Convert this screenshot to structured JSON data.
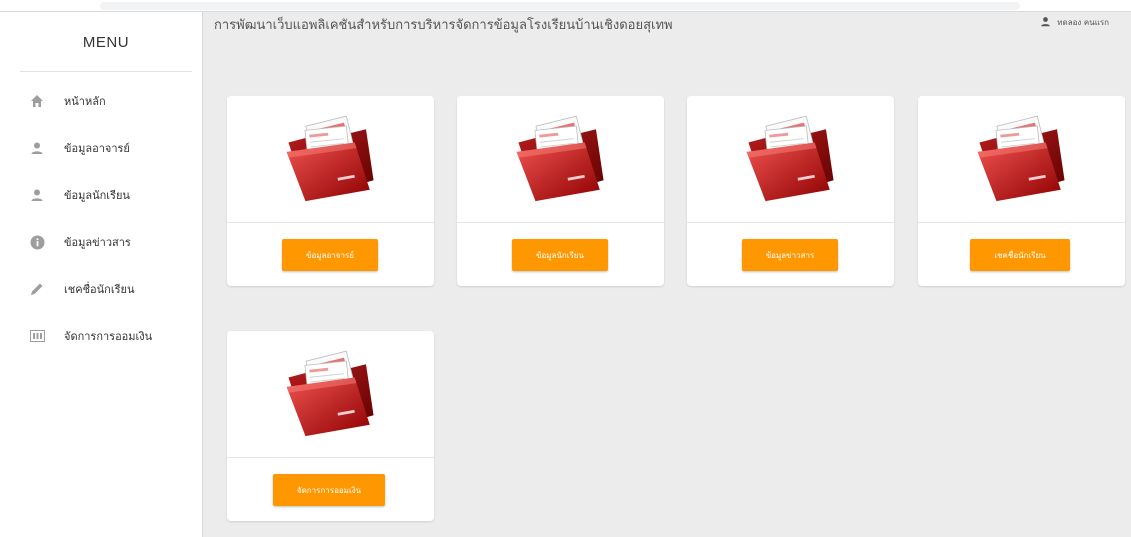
{
  "app": {
    "title": "การพัฒนาเว็บแอพลิเคชันสำหรับการบริหารจัดการข้อมูลโรงเรียนบ้านเชิงดอยสุเทพ",
    "user_name": "ทดลอง คนแรก"
  },
  "sidebar": {
    "title": "MENU",
    "items": [
      {
        "label": "หน้าหลัก",
        "icon": "home-icon"
      },
      {
        "label": "ข้อมูลอาจารย์",
        "icon": "person-icon"
      },
      {
        "label": "ข้อมูลนักเรียน",
        "icon": "person-icon"
      },
      {
        "label": "ข้อมูลข่าวสาร",
        "icon": "info-icon"
      },
      {
        "label": "เชคชื่อนักเรียน",
        "icon": "pencil-icon"
      },
      {
        "label": "จัดการการออมเงิน",
        "icon": "money-icon"
      }
    ]
  },
  "cards": [
    {
      "button": "ข้อมูลอาจารย์",
      "icon": "red-folder-icon"
    },
    {
      "button": "ข้อมูลนักเรียน",
      "icon": "red-folder-icon"
    },
    {
      "button": "ข้อมูลข่าวสาร",
      "icon": "red-folder-icon"
    },
    {
      "button": "เชคชื่อนักเรียน",
      "icon": "red-folder-icon"
    },
    {
      "button": "จัดการการออมเงิน",
      "icon": "red-folder-icon"
    }
  ],
  "colors": {
    "accent": "#ff9800",
    "folder": "#c62828",
    "sidebar_bg": "#ffffff",
    "content_bg": "#ececec"
  }
}
